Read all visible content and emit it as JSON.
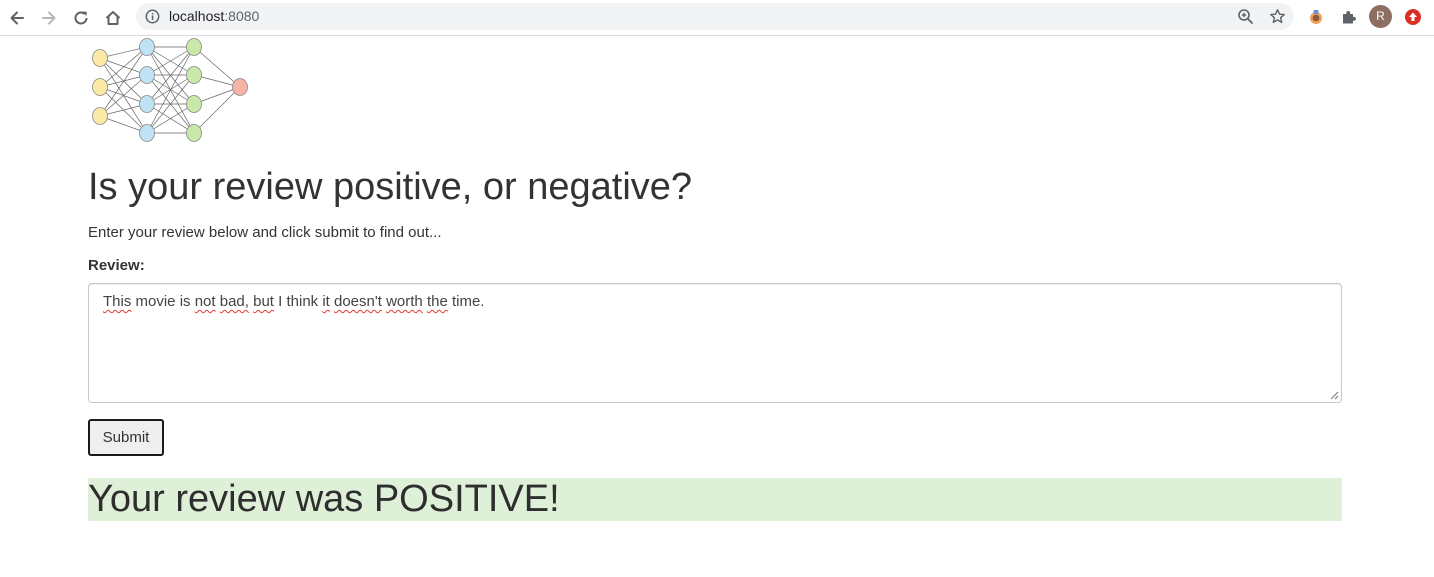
{
  "browser": {
    "url_host": "localhost",
    "url_port": ":8080",
    "profile_initial": "R"
  },
  "page": {
    "heading": "Is your review positive, or negative?",
    "instructions": "Enter your review below and click submit to find out...",
    "review_label": "Review:",
    "review_text_parts": [
      "This",
      " movie is ",
      "not",
      " ",
      "bad,",
      " ",
      "but",
      " I think ",
      "it",
      " ",
      "doesn't",
      " ",
      "worth",
      " ",
      "the",
      " time."
    ],
    "submit_label": "Submit",
    "result": "Your review was POSITIVE!"
  },
  "colors": {
    "result_background": "#dff0d8",
    "input_node": "#fde9a6",
    "hidden_node_1": "#bfe3f5",
    "hidden_node_2": "#c9e9a9",
    "output_node": "#f6b3a6"
  },
  "icons": [
    "back-arrow-icon",
    "forward-arrow-icon",
    "reload-icon",
    "home-icon",
    "info-icon",
    "zoom-icon",
    "star-icon",
    "extension-icon",
    "puzzle-icon",
    "update-icon",
    "neural-network-logo"
  ]
}
